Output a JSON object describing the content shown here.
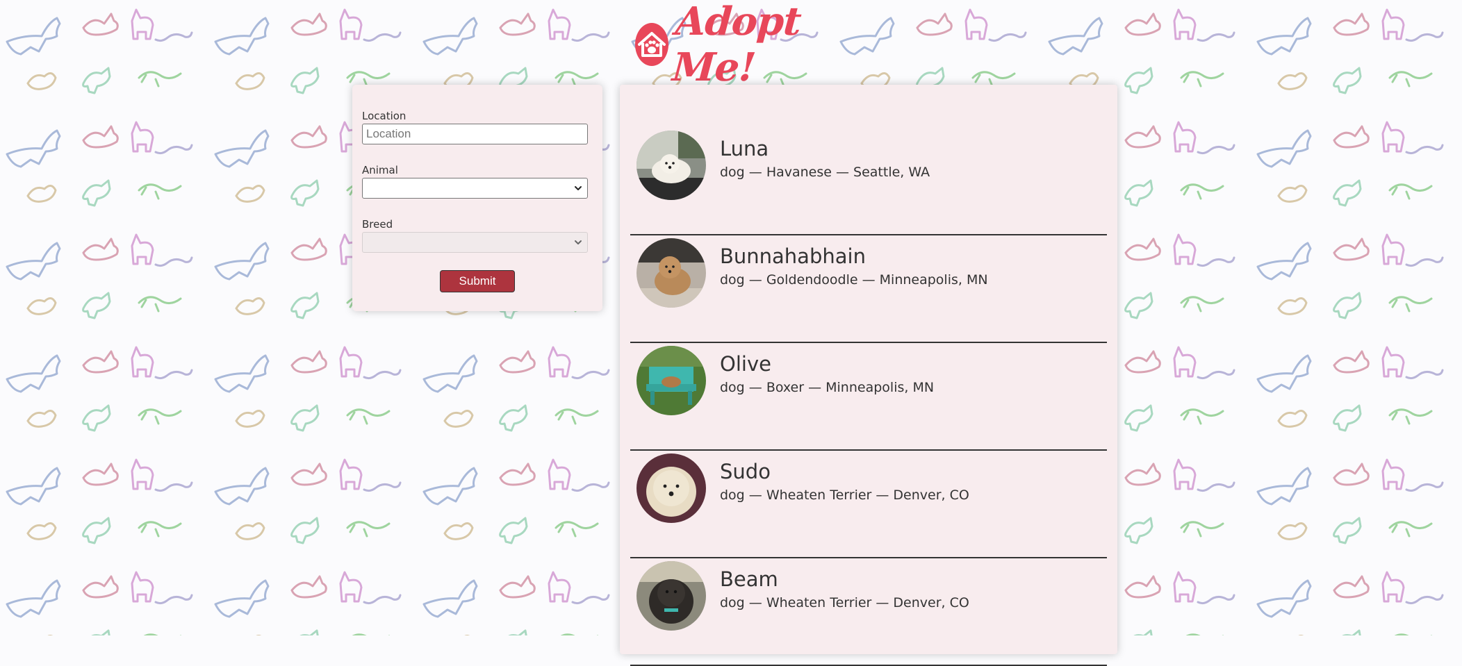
{
  "brand": {
    "name": "Adopt Me!"
  },
  "search_form": {
    "location_label": "Location",
    "location_placeholder": "Location",
    "location_value": "",
    "animal_label": "Animal",
    "animal_value": "",
    "breed_label": "Breed",
    "breed_value": "",
    "submit_label": "Submit"
  },
  "pets": [
    {
      "name": "Luna",
      "info": "dog — Havanese — Seattle, WA"
    },
    {
      "name": "Bunnahabhain",
      "info": "dog — Goldendoodle — Minneapolis, MN"
    },
    {
      "name": "Olive",
      "info": "dog — Boxer — Minneapolis, MN"
    },
    {
      "name": "Sudo",
      "info": "dog — Wheaten Terrier — Denver, CO"
    },
    {
      "name": "Beam",
      "info": "dog — Wheaten Terrier — Denver, CO"
    }
  ],
  "colors": {
    "brand": "#e8475a",
    "panel": "#f8ecee",
    "button": "#ad343e"
  }
}
